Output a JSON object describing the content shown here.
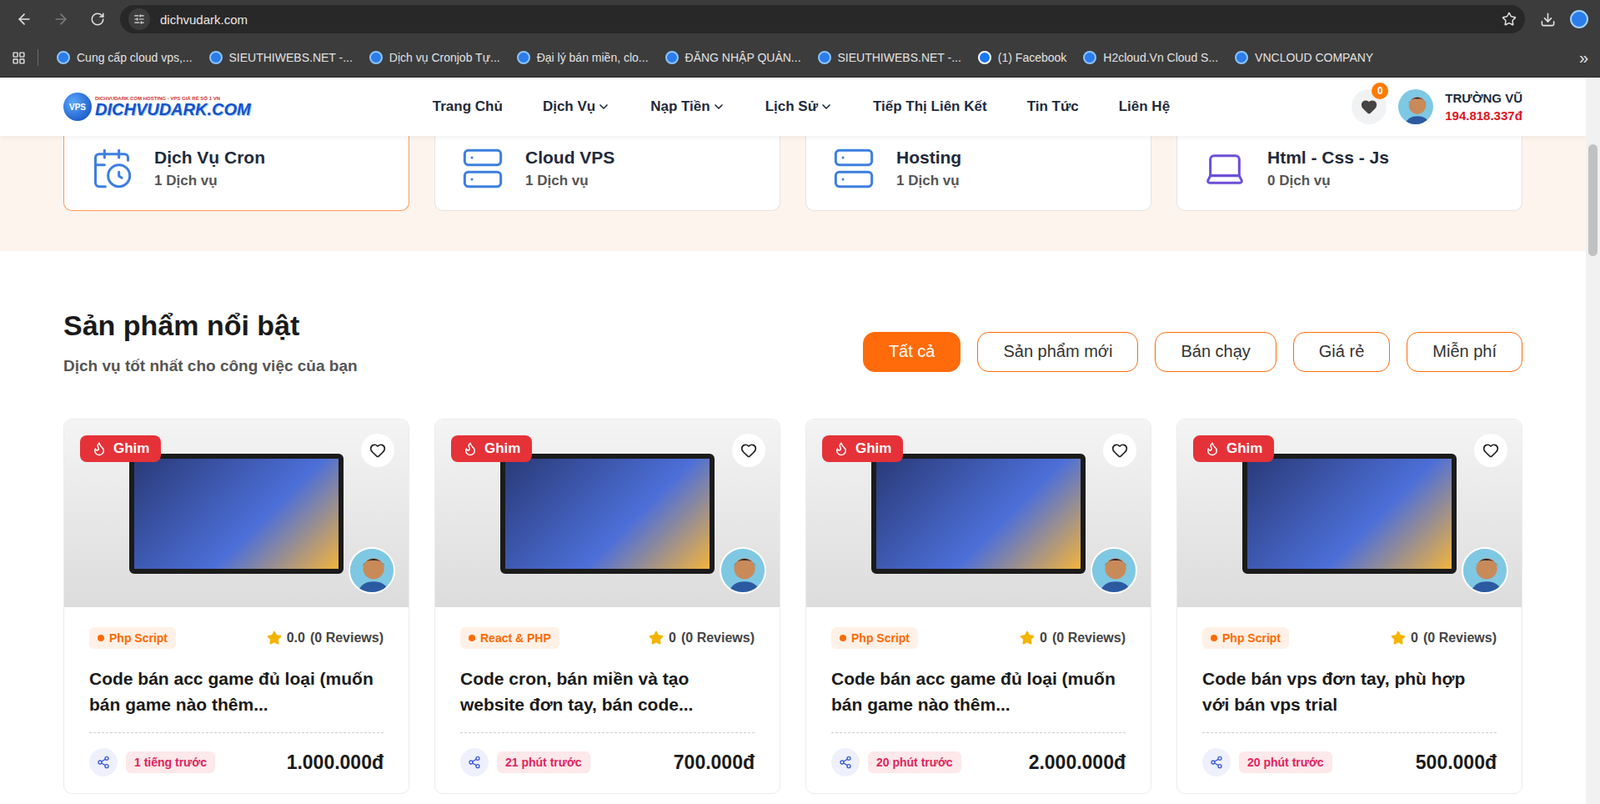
{
  "browser": {
    "url": "dichvudark.com",
    "back_enabled": true,
    "forward_enabled": false,
    "bookmarked": false
  },
  "bookmarks": [
    {
      "label": "Cung cấp cloud vps,...",
      "kind": "site"
    },
    {
      "label": "SIEUTHIWEBS.NET -...",
      "kind": "site"
    },
    {
      "label": "Dịch vụ Cronjob Tự...",
      "kind": "site"
    },
    {
      "label": "Đại lý bán miền, clo...",
      "kind": "site"
    },
    {
      "label": "ĐĂNG NHẬP QUẢN...",
      "kind": "site"
    },
    {
      "label": "SIEUTHIWEBS.NET -...",
      "kind": "site"
    },
    {
      "label": "(1) Facebook",
      "kind": "facebook"
    },
    {
      "label": "H2cloud.Vn Cloud S...",
      "kind": "site"
    },
    {
      "label": "VNCLOUD COMPANY",
      "kind": "site"
    }
  ],
  "bookmarks_overflow": "»",
  "site": {
    "logo": {
      "badge": "VPS",
      "tagline": "DICHVUDARK.COM HOSTING - VPS GIÁ RẺ SỐ 1 VN",
      "name": "DICHVUDARK.COM"
    },
    "nav": [
      {
        "label": "Trang Chủ",
        "has_menu": false
      },
      {
        "label": "Dịch Vụ",
        "has_menu": true
      },
      {
        "label": "Nạp Tiền",
        "has_menu": true
      },
      {
        "label": "Lịch Sử",
        "has_menu": true
      },
      {
        "label": "Tiếp Thị Liên Kết",
        "has_menu": false
      },
      {
        "label": "Tin Tức",
        "has_menu": false
      },
      {
        "label": "Liên Hệ",
        "has_menu": false
      }
    ],
    "favorites_count": "0",
    "user": {
      "name": "TRƯỜNG VŨ",
      "balance": "194.818.337đ"
    }
  },
  "categories": [
    {
      "name": "Dịch Vụ Cron",
      "count": "1 Dịch vụ",
      "kind": "cron",
      "selected": true
    },
    {
      "name": "Cloud VPS",
      "count": "1 Dịch vụ",
      "kind": "cloud",
      "selected": false
    },
    {
      "name": "Hosting",
      "count": "1 Dịch vụ",
      "kind": "hosting",
      "selected": false
    },
    {
      "name": "Html - Css - Js",
      "count": "0 Dịch vụ",
      "kind": "code",
      "selected": false
    }
  ],
  "section": {
    "title": "Sản phẩm nổi bật",
    "subtitle": "Dịch vụ tốt nhất cho công việc của bạn"
  },
  "filters": [
    {
      "label": "Tất cả",
      "selected": true
    },
    {
      "label": "Sản phẩm mới",
      "selected": false
    },
    {
      "label": "Bán chạy",
      "selected": false
    },
    {
      "label": "Giá rẻ",
      "selected": false
    },
    {
      "label": "Miễn phí",
      "selected": false
    }
  ],
  "products": [
    {
      "pinned_label": "Ghim",
      "favorite": false,
      "tag": "Php Script",
      "rating": "0.0",
      "reviews": "(0 Reviews)",
      "title": "Code bán acc game đủ loại (muốn bán game nào thêm...",
      "time": "1 tiếng trước",
      "price": "1.000.000đ"
    },
    {
      "pinned_label": "Ghim",
      "favorite": false,
      "tag": "React & PHP",
      "rating": "0",
      "reviews": "(0 Reviews)",
      "title": "Code cron, bán miền và tạo website đơn tay, bán code...",
      "time": "21 phút trước",
      "price": "700.000đ"
    },
    {
      "pinned_label": "Ghim",
      "favorite": false,
      "tag": "Php Script",
      "rating": "0",
      "reviews": "(0 Reviews)",
      "title": "Code bán acc game đủ loại (muốn bán game nào thêm...",
      "time": "20 phút trước",
      "price": "2.000.000đ"
    },
    {
      "pinned_label": "Ghim",
      "favorite": false,
      "tag": "Php Script",
      "rating": "0",
      "reviews": "(0 Reviews)",
      "title": "Code bán vps đơn tay, phù hợp với bán vps trial",
      "time": "20 phút trước",
      "price": "500.000đ"
    }
  ],
  "scrollbar": {
    "thumb_start": 0.09,
    "thumb_size": 0.155
  }
}
